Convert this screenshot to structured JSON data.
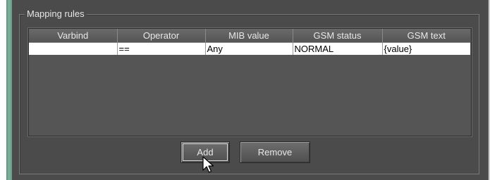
{
  "mapping_rules": {
    "title": "Mapping rules",
    "columns": [
      "Varbind",
      "Operator",
      "MIB value",
      "GSM status",
      "GSM text"
    ],
    "rows": [
      {
        "varbind": "",
        "operator": "==",
        "mib_value": "Any",
        "gsm_status": "NORMAL",
        "gsm_text": "{value}"
      }
    ],
    "add_label": "Add",
    "remove_label": "Remove"
  },
  "icons": {
    "cursor": "mouse-pointer-icon"
  },
  "colors": {
    "panel_bg": "#4b4b4b",
    "header_bg": "#5e5e5e",
    "row_bg": "#ffffff",
    "accent_strip": "#7fb3a0"
  }
}
